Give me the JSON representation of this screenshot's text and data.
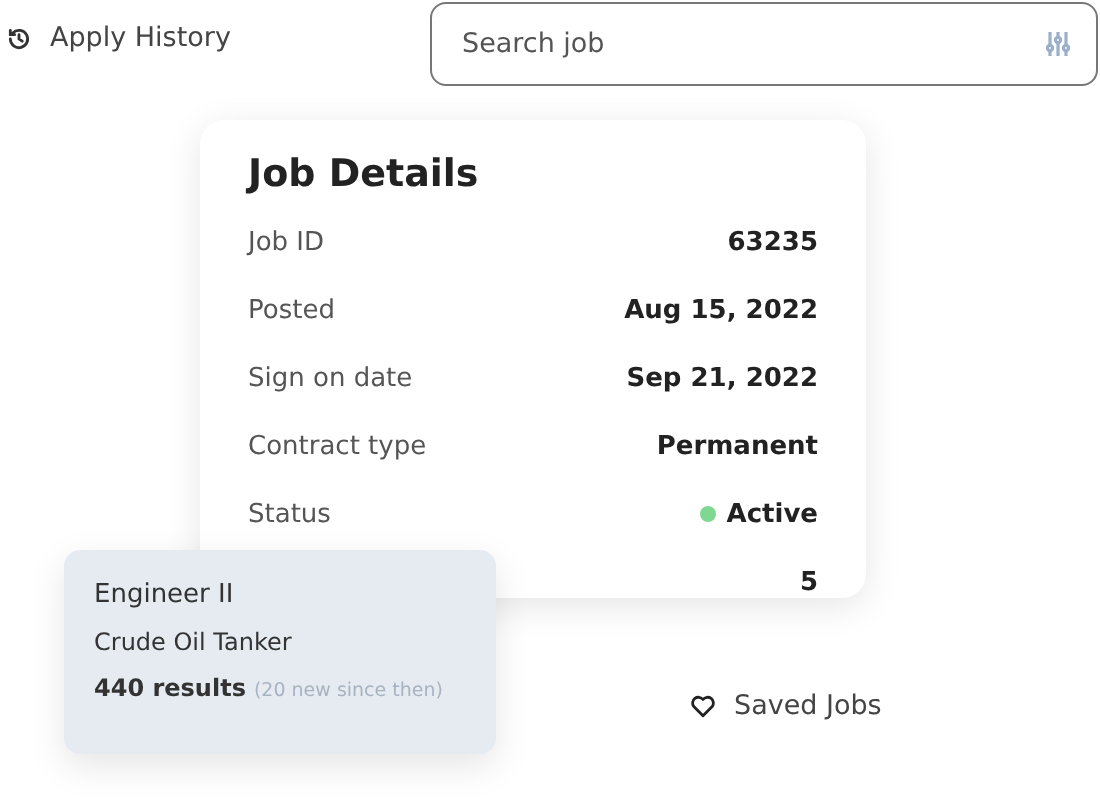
{
  "history_link": {
    "label": "Apply History"
  },
  "search": {
    "placeholder": "Search job"
  },
  "job_details": {
    "title": "Job Details",
    "rows": [
      {
        "kind": "text",
        "label": "Job ID",
        "value": "63235"
      },
      {
        "kind": "text",
        "label": "Posted",
        "value": "Aug 15, 2022"
      },
      {
        "kind": "text",
        "label": "Sign on date",
        "value": "Sep 21, 2022"
      },
      {
        "kind": "text",
        "label": "Contract type",
        "value": "Permanent"
      },
      {
        "kind": "status",
        "label": "Status",
        "value": "Active",
        "color": "#7ed891"
      },
      {
        "kind": "text",
        "value": "5"
      }
    ]
  },
  "saved_search": {
    "title": "Engineer II",
    "subtitle": "Crude Oil Tanker",
    "results": "440 results",
    "note": "(20 new since then)"
  },
  "saved_jobs_link": {
    "label": "Saved Jobs"
  }
}
